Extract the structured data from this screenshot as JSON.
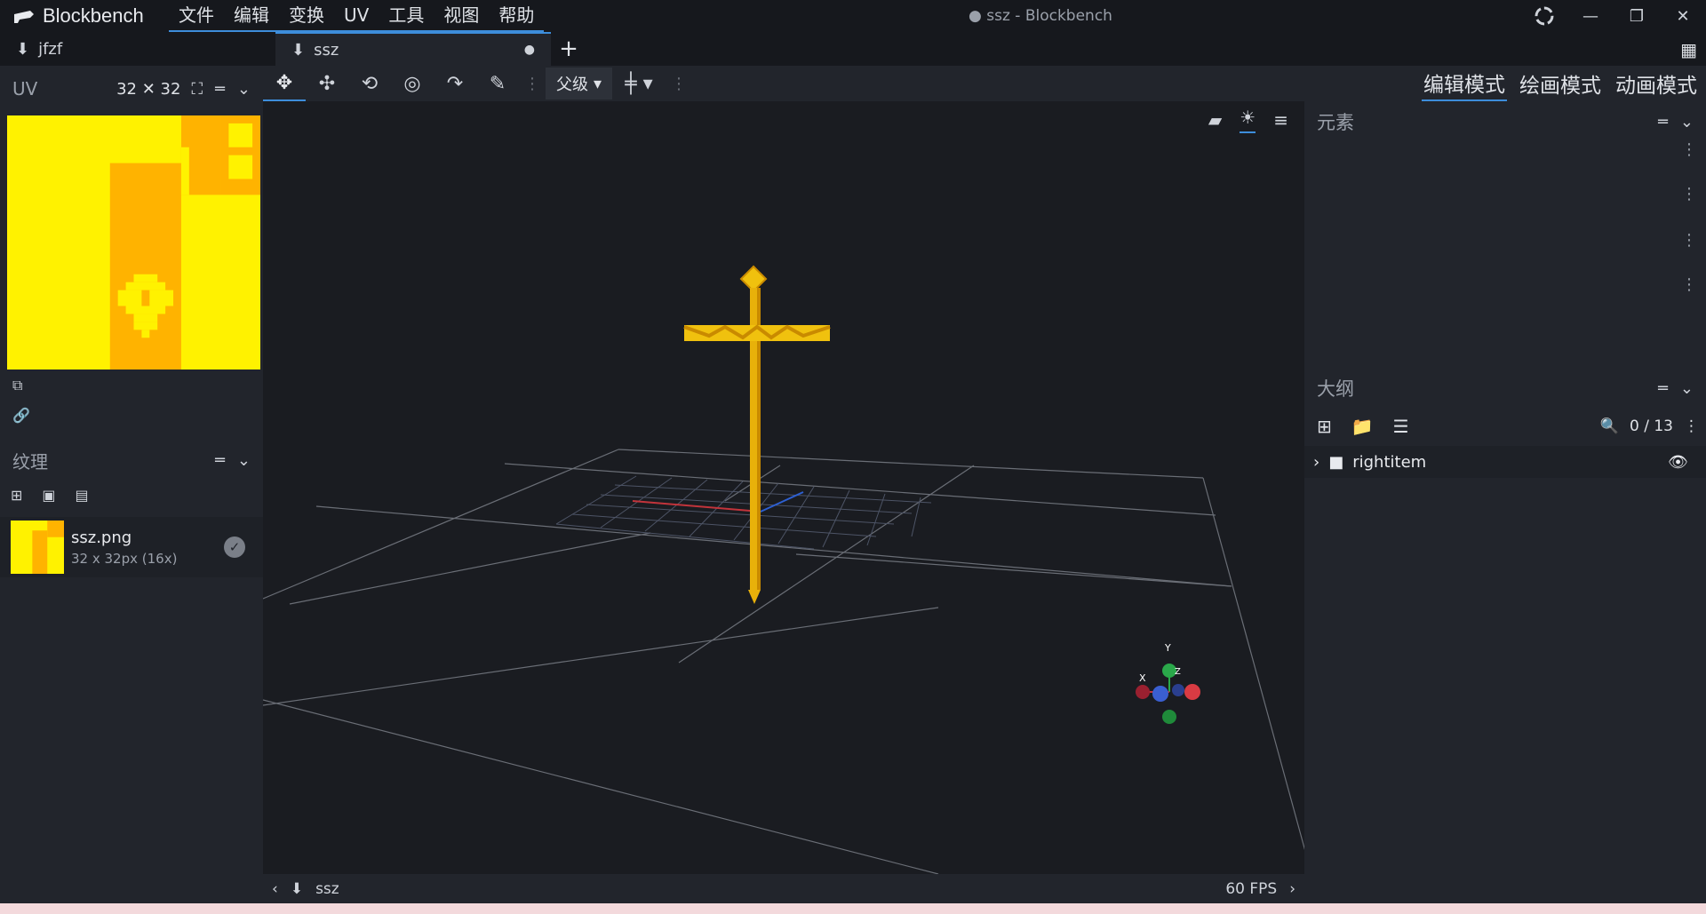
{
  "app": {
    "name": "Blockbench",
    "window_title": "● ssz - Blockbench"
  },
  "menu": [
    "文件",
    "编辑",
    "变换",
    "UV",
    "工具",
    "视图",
    "帮助"
  ],
  "tabs": [
    {
      "label": "jfzf",
      "active": false
    },
    {
      "label": "ssz",
      "active": true,
      "unsaved_marker": "●"
    }
  ],
  "uv_panel": {
    "title": "UV",
    "size": "32 ✕ 32"
  },
  "textures_panel": {
    "title": "纹理",
    "item": {
      "name": "ssz.png",
      "size": "32 x 32px (16x)"
    }
  },
  "toolbar": {
    "pivot_label": "父级"
  },
  "modes": [
    {
      "label": "编辑模式",
      "active": true
    },
    {
      "label": "绘画模式",
      "active": false
    },
    {
      "label": "动画模式",
      "active": false
    }
  ],
  "elements_panel": {
    "title": "元素"
  },
  "outliner": {
    "title": "大纲",
    "count": "0 / 13",
    "items": [
      {
        "label": "rightitem"
      }
    ]
  },
  "statusbar": {
    "project": "ssz",
    "fps": "60 FPS"
  },
  "axis_labels": {
    "x": "X",
    "y": "Y",
    "z": "Z"
  },
  "colors": {
    "accent": "#3d8ddb",
    "texture_yellow": "#fff200",
    "texture_orange": "#ffb300",
    "sword_gold": "#e8b10a"
  }
}
